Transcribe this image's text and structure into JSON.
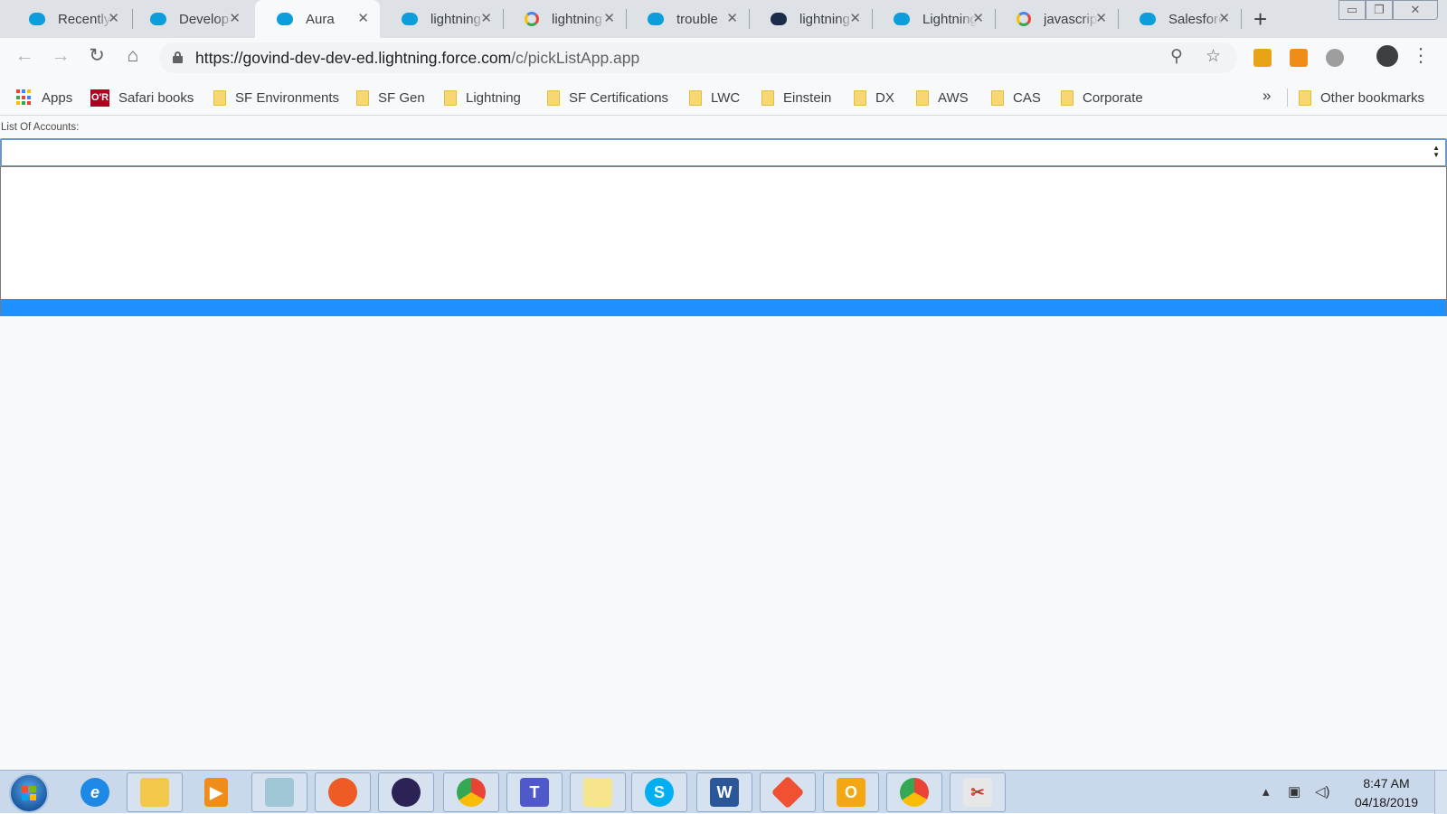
{
  "tabs": [
    {
      "title": "Recently",
      "icon": "salesforce-cloud-icon"
    },
    {
      "title": "Develop",
      "icon": "salesforce-cloud-icon"
    },
    {
      "title": "Aura",
      "icon": "salesforce-cloud-icon",
      "active": true
    },
    {
      "title": "lightning",
      "icon": "salesforce-cloud-icon"
    },
    {
      "title": "lightning",
      "icon": "google-icon"
    },
    {
      "title": "trouble",
      "icon": "salesforce-cloud-icon"
    },
    {
      "title": "lightning",
      "icon": "dark-cloud-icon"
    },
    {
      "title": "Lightning",
      "icon": "salesforce-cloud-icon"
    },
    {
      "title": "javascript",
      "icon": "google-icon"
    },
    {
      "title": "Salesforce",
      "icon": "salesforce-cloud-icon"
    }
  ],
  "tab_close_glyph": "✕",
  "new_tab_glyph": "+",
  "window_controls": {
    "minimize": "▭",
    "restore": "❐",
    "close": "✕"
  },
  "toolbar": {
    "back": "←",
    "forward": "→",
    "reload": "↻",
    "home": "⌂",
    "url_host": "https://govind-dev-dev-ed.lightning.force.com",
    "url_path": "/c/pickListApp.app",
    "zoom": "⚲",
    "star": "☆",
    "menu": "⋮"
  },
  "bookmarks": {
    "apps": "Apps",
    "safari_logo": "O'R",
    "safari": "Safari books",
    "folders": [
      "SF Environments",
      "SF Gen",
      "Lightning",
      "SF Certifications",
      "LWC",
      "Einstein",
      "DX",
      "AWS",
      "CAS",
      "Corporate"
    ],
    "more": "»",
    "other": "Other bookmarks"
  },
  "page": {
    "label": "List Of Accounts:",
    "select_value": "",
    "spinner_up": "▲",
    "spinner_down": "▼"
  },
  "taskbar": {
    "time": "8:47 AM",
    "date": "04/18/2019",
    "apps": [
      "internet-explorer",
      "file-explorer",
      "media-player",
      "notepad",
      "postman",
      "eclipse",
      "chrome",
      "teams",
      "sticky-notes",
      "skype",
      "word",
      "git",
      "outlook",
      "chrome",
      "snipping-tool"
    ]
  },
  "colors": {
    "selection": "#1e90ff",
    "select_border": "#6f96c9",
    "tabstrip": "#dee1e6",
    "taskbar": "#c9d8ea"
  }
}
